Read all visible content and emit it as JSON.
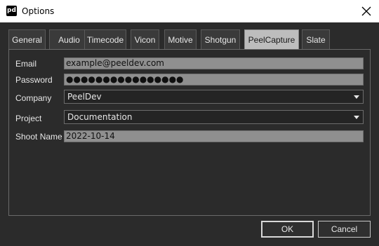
{
  "window": {
    "title": "Options",
    "app_icon_text": "pd",
    "close_icon": "close-icon"
  },
  "tabs": [
    {
      "label": "General"
    },
    {
      "label": "Audio"
    },
    {
      "label": "Timecode"
    },
    {
      "label": "Vicon"
    },
    {
      "label": "Motive"
    },
    {
      "label": "Shotgun"
    },
    {
      "label": "PeelCapture",
      "active": true
    },
    {
      "label": "Slate"
    }
  ],
  "form": {
    "email_label": "Email",
    "email_value": "example@peeldev.com",
    "password_label": "Password",
    "password_value": "●●●●●●●●●●●●●●●●",
    "company_label": "Company",
    "company_value": "PeelDev",
    "project_label": "Project",
    "project_value": "Documentation",
    "shoot_name_label": "Shoot Name",
    "shoot_name_value": "2022-10-14"
  },
  "buttons": {
    "ok": "OK",
    "cancel": "Cancel"
  },
  "colors": {
    "background": "#2b2b2b",
    "active_tab": "#bdbdbd",
    "field": "#8f8f8f"
  }
}
